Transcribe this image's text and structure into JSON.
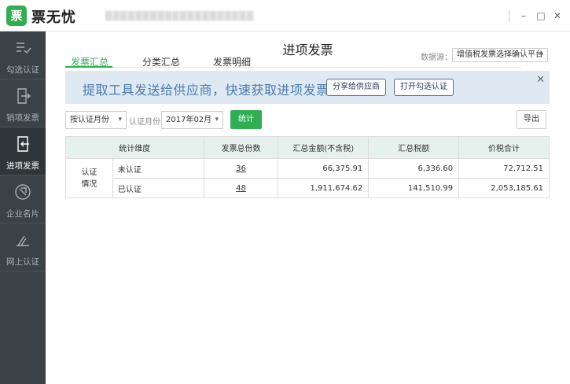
{
  "app": {
    "logo_char": "票",
    "name": "票无忧",
    "company": "▒▒▒▒▒▒▒▒▒▒▒▒▒▒▒▒▒▒▒▒"
  },
  "window": {
    "minimize": "–",
    "maximize": "□",
    "close": "✕"
  },
  "sidebar": {
    "items": [
      {
        "label": "勾选认证",
        "icon": "checklist-icon",
        "active": false
      },
      {
        "label": "销项发票",
        "icon": "export-doc-icon",
        "active": false
      },
      {
        "label": "进项发票",
        "icon": "import-doc-icon",
        "active": true
      },
      {
        "label": "企业名片",
        "icon": "card-icon",
        "active": false
      },
      {
        "label": "网上认证",
        "icon": "online-cert-icon",
        "active": false
      }
    ]
  },
  "page": {
    "title": "进项发票"
  },
  "tabs": [
    {
      "label": "发票汇总",
      "active": true
    },
    {
      "label": "分类汇总",
      "active": false
    },
    {
      "label": "发票明细",
      "active": false
    }
  ],
  "source": {
    "label": "数据源：",
    "value": "增值税发票选择确认平台"
  },
  "banner": {
    "text": "提取工具发送给供应商，快速获取进项发票",
    "share_btn": "分享给供应商",
    "open_btn": "打开勾选认证",
    "close": "✕"
  },
  "filters": {
    "mode_value": "按认证月份",
    "month_label": "认证月份",
    "month_value": "2017年02月",
    "stat_btn": "统计",
    "export_btn": "导出"
  },
  "table": {
    "headers": [
      "统计维度",
      "发票总份数",
      "汇总金额(不含税)",
      "汇总税额",
      "价税合计"
    ],
    "group_label": "认证情况",
    "rows": [
      {
        "dimension": "未认证",
        "count": "36",
        "amount": "66,375.91",
        "tax": "6,336.60",
        "total": "72,712.51"
      },
      {
        "dimension": "已认证",
        "count": "48",
        "amount": "1,911,674.62",
        "tax": "141,510.99",
        "total": "2,053,185.61"
      }
    ]
  },
  "colors": {
    "accent": "#2fae52",
    "sidebar": "#3b4246",
    "banner_bg": "#dfe9f1",
    "table_header": "#e6f0ed"
  }
}
